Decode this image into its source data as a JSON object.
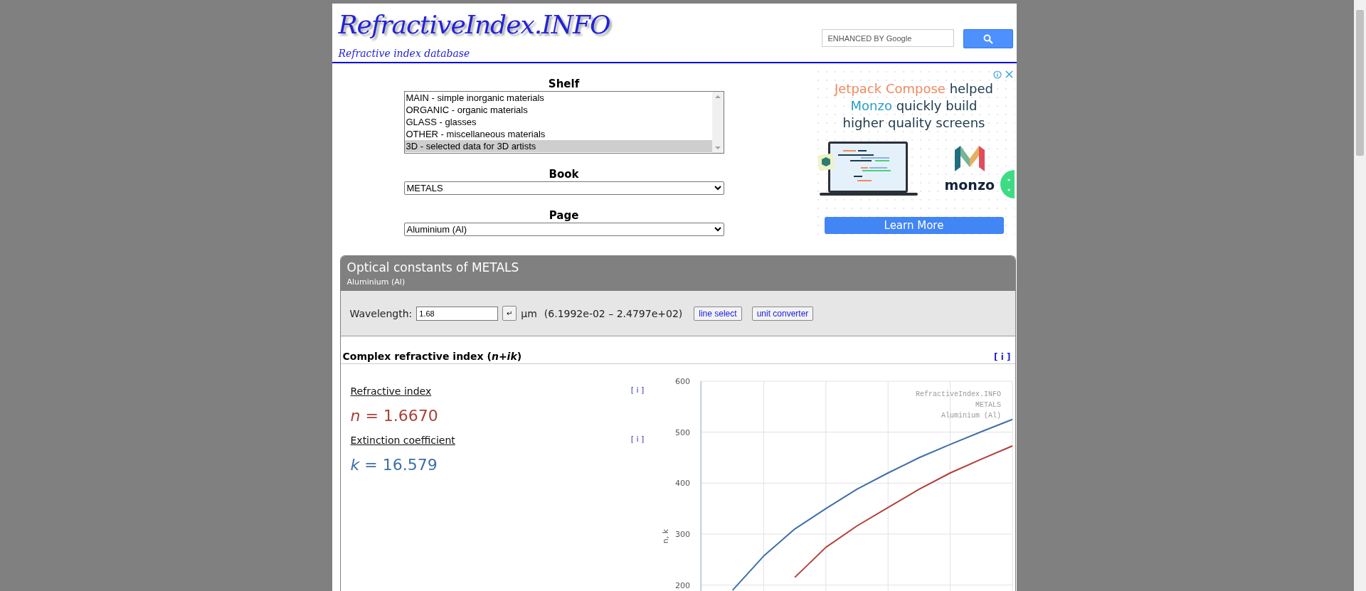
{
  "site": {
    "title": "RefractiveIndex.INFO",
    "subtitle": "Refractive index database"
  },
  "search": {
    "placeholder": "ENHANCED BY Google"
  },
  "shelf": {
    "label": "Shelf",
    "options": [
      {
        "label": "MAIN - simple inorganic materials",
        "selected": false
      },
      {
        "label": "ORGANIC - organic materials",
        "selected": false
      },
      {
        "label": "GLASS - glasses",
        "selected": false
      },
      {
        "label": "OTHER - miscellaneous materials",
        "selected": false
      },
      {
        "label": "3D - selected data for 3D artists",
        "selected": true
      }
    ]
  },
  "book": {
    "label": "Book",
    "value": "METALS"
  },
  "page": {
    "label": "Page",
    "value": "Aluminium (Al)"
  },
  "ad": {
    "headline": [
      {
        "text": "Jetpack Compose",
        "color": "#f08a5d"
      },
      {
        "text": " helped ",
        "color": "#1b3a4b"
      },
      {
        "text": "Monzo",
        "color": "#2a9ec4"
      },
      {
        "text": " quickly build higher quality screens",
        "color": "#1b3a4b"
      }
    ],
    "brand": "monzo",
    "button": "Learn More"
  },
  "panel": {
    "title": "Optical constants of METALS",
    "subtitle": "Aluminium (Al)",
    "wavelength_label": "Wavelength:",
    "wavelength_value": "1.68",
    "enter_button": "↵",
    "unit": "µm",
    "range": "(6.1992e-02 – 2.4797e+02)",
    "buttons": [
      "line select",
      "unit converter"
    ],
    "section_title": "Complex refractive index (*n+ik*)",
    "info_link": "[ i ]",
    "quantities": [
      {
        "label": "Refractive index",
        "info": "[ i ]",
        "value": "*n* = 1.6670",
        "color": "#a84238"
      },
      {
        "label": "Extinction coefficient",
        "info": "[ i ]",
        "value": "*k* = 16.579",
        "color": "#3f6fa8"
      }
    ],
    "chart_data": {
      "type": "line",
      "ylabel": "n, k",
      "ylim": [
        187,
        600
      ],
      "yticks": [
        200,
        300,
        400,
        500,
        600
      ],
      "grid": true,
      "categories": [
        null,
        null,
        null,
        null,
        null,
        null,
        null,
        null,
        null,
        null,
        null
      ],
      "series": [
        {
          "color": "#3f6fa8",
          "values": [
            null,
            190,
            257,
            310,
            350,
            388,
            420,
            450,
            476,
            501,
            525
          ]
        },
        {
          "color": "#b0403a",
          "values": [
            null,
            null,
            null,
            215,
            274,
            316,
            352,
            388,
            420,
            447,
            473
          ]
        }
      ],
      "annotations": [
        "RefractiveIndex.INFO",
        "METALS",
        "Aluminium (Al)"
      ]
    }
  }
}
